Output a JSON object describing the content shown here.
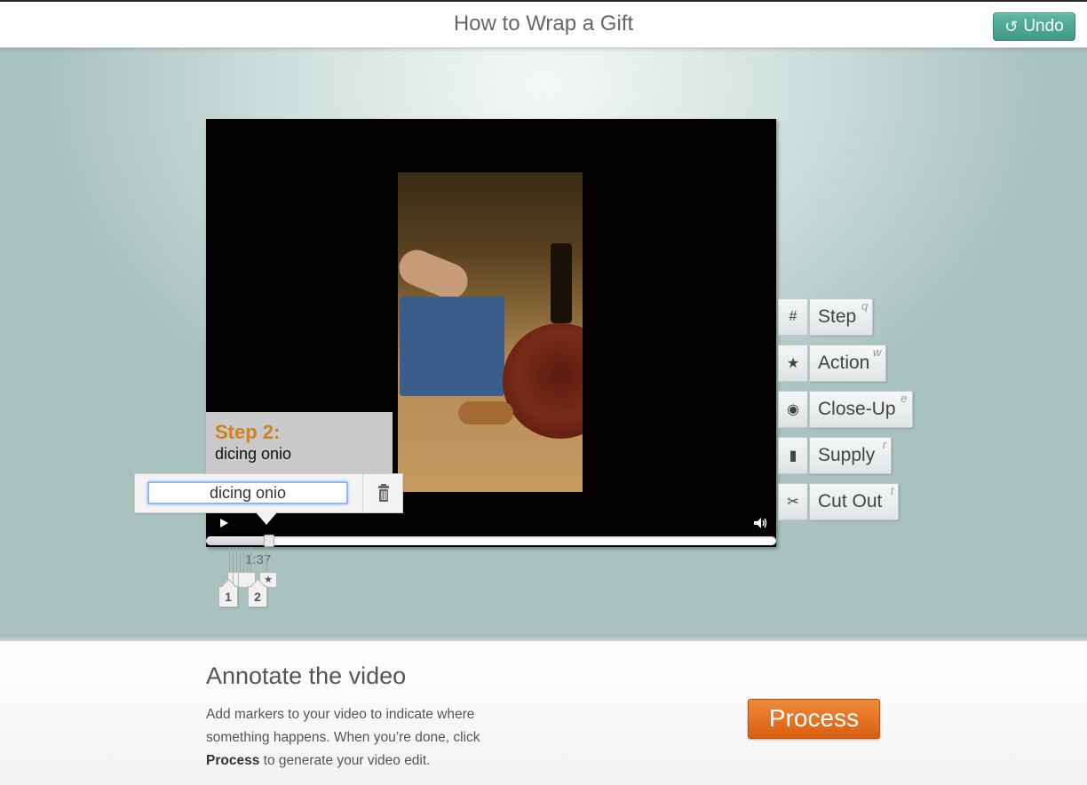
{
  "header": {
    "title": "How to Wrap a Gift",
    "undo_label": "Undo"
  },
  "video": {
    "caption_step": "Step 2:",
    "caption_text": "dicing onio",
    "editor_value": "dicing onio",
    "current_time": "1:37",
    "progress_fraction": 0.11
  },
  "timeline": {
    "markers": [
      {
        "label": "1"
      },
      {
        "label": "2"
      }
    ],
    "action_marker_symbol": "★"
  },
  "tools": [
    {
      "icon": "hash-icon",
      "symbol": "#",
      "label": "Step",
      "key": "q"
    },
    {
      "icon": "star-icon",
      "symbol": "★",
      "label": "Action",
      "key": "w"
    },
    {
      "icon": "eye-icon",
      "symbol": "◉",
      "label": "Close-Up",
      "key": "e"
    },
    {
      "icon": "bag-icon",
      "symbol": "▮",
      "label": "Supply",
      "key": "r"
    },
    {
      "icon": "scissors-icon",
      "symbol": "✂",
      "label": "Cut Out",
      "key": "t"
    }
  ],
  "panel": {
    "title": "Annotate the video",
    "desc_part1": "Add markers to your video to indicate where something happens. When you’re done, click",
    "desc_bold": "Process",
    "desc_part2": "to generate your video edit.",
    "process_label": "Process"
  },
  "colors": {
    "accent_teal": "#4aa893",
    "process_orange": "#e8731f",
    "step_orange": "#d1801f"
  }
}
